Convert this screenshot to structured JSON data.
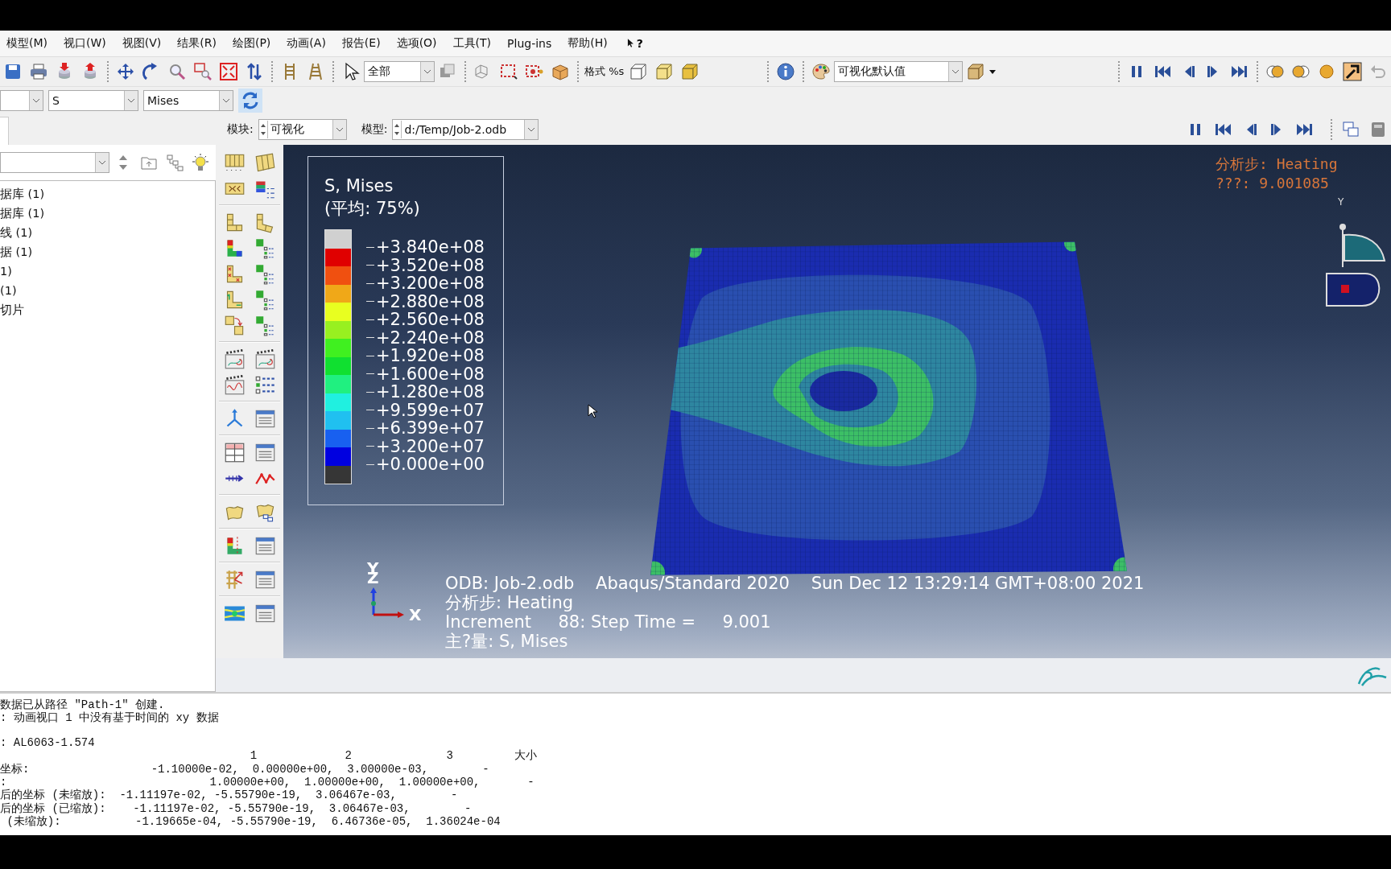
{
  "menu": [
    "模型(M)",
    "视口(W)",
    "视图(V)",
    "结果(R)",
    "绘图(P)",
    "动画(A)",
    "报告(E)",
    "选项(O)",
    "工具(T)",
    "Plug-ins",
    "帮助(H)"
  ],
  "context_help": "?",
  "toolbar": {
    "selection_filter": "全部",
    "format_label": "格式 %s",
    "render_style": "可视化默认值"
  },
  "field_output": {
    "variable": "S",
    "invariant": "Mises"
  },
  "context": {
    "module_label": "模块:",
    "module": "可视化",
    "model_label": "模型:",
    "model": "d:/Temp/Job-2.odb"
  },
  "model_tree": {
    "items": [
      {
        "label": "据库 (1)"
      },
      {
        "label": "据库 (1)"
      },
      {
        "label": "线 (1)"
      },
      {
        "label": "据 (1)"
      },
      {
        "label": "1)"
      },
      {
        "label": "(1)"
      },
      {
        "label": "切片"
      }
    ]
  },
  "viewport": {
    "legend": {
      "title": "S, Mises",
      "subtitle": "(平均: 75%)",
      "bands": [
        {
          "color": "#d0d0d0"
        },
        {
          "color": "#e00000"
        },
        {
          "color": "#f05010"
        },
        {
          "color": "#f0a818"
        },
        {
          "color": "#e8ff20"
        },
        {
          "color": "#98f020"
        },
        {
          "color": "#40f020"
        },
        {
          "color": "#10e030"
        },
        {
          "color": "#20f080"
        },
        {
          "color": "#20f0e0"
        },
        {
          "color": "#20c0f0"
        },
        {
          "color": "#1860f0"
        },
        {
          "color": "#0000e0"
        },
        {
          "color": "#363636"
        }
      ],
      "ticks": [
        "+3.840e+08",
        "+3.520e+08",
        "+3.200e+08",
        "+2.880e+08",
        "+2.560e+08",
        "+2.240e+08",
        "+1.920e+08",
        "+1.600e+08",
        "+1.280e+08",
        "+9.599e+07",
        "+6.399e+07",
        "+3.200e+07",
        "+0.000e+00"
      ]
    },
    "step_info": [
      "分析步: Heating",
      "???: 9.001085"
    ],
    "view_cube": {
      "axis": "Y"
    },
    "triad": {
      "y": "Y",
      "z": "Z",
      "x": "X"
    },
    "info_lines": [
      "ODB: Job-2.odb    Abaqus/Standard 2020    Sun Dec 12 13:29:14 GMT+08:00 2021",
      "分析步: Heating",
      "Increment     88: Step Time =     9.001",
      "主?量: S, Mises"
    ]
  },
  "message_area": {
    "lines": [
      "数据已从路径 \"Path-1\" 创建.",
      ": 动画视口 1 中没有基于时间的 xy 数据"
    ],
    "result_lines": [
      ": AL6063-1.574",
      "                                     1             2              3         大小",
      "坐标:                  -1.10000e-02,  0.00000e+00,  3.00000e-03,        -",
      ":                              1.00000e+00,  1.00000e+00,  1.00000e+00,       -",
      "后的坐标 (未缩放):  -1.11197e-02, -5.55790e-19,  3.06467e-03,        -",
      "后的坐标 (已缩放):    -1.11197e-02, -5.55790e-19,  3.06467e-03,        -",
      " (未缩放):           -1.19665e-04, -5.55790e-19,  6.46736e-05,  1.36024e-04"
    ]
  }
}
